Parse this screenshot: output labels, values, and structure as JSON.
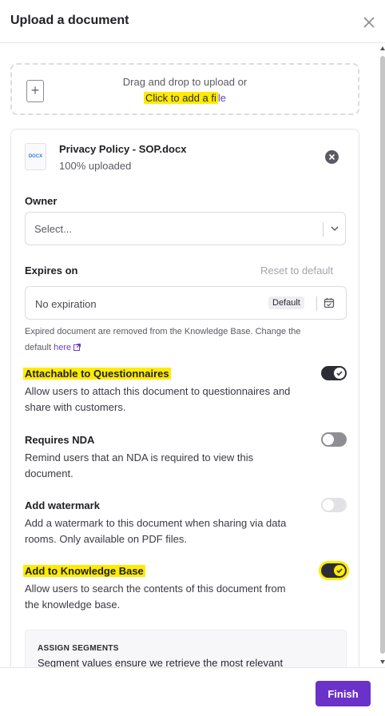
{
  "header": {
    "title": "Upload a document"
  },
  "dropzone": {
    "instruction": "Drag and drop to upload or",
    "link_text": "Click to add a fi",
    "link_tail": "le",
    "plus": "+"
  },
  "file": {
    "icon_label": "DOCX",
    "name": "Privacy Policy - SOP.docx",
    "status": "100% uploaded"
  },
  "owner": {
    "label": "Owner",
    "placeholder": "Select..."
  },
  "expires": {
    "label": "Expires on",
    "reset_label": "Reset to default",
    "value": "No expiration",
    "badge": "Default",
    "help_text_1": "Expired document are removed from the Knowledge Base. Change the",
    "help_text_2": "default",
    "help_link": "here"
  },
  "settings": [
    {
      "label": "Attachable to Questionnaires",
      "desc_1": "Allow users to attach this document to questionnaires and",
      "desc_2": "share with customers.",
      "state": "on"
    },
    {
      "label": "Requires NDA",
      "desc_1": "Remind users that an NDA is required to view this",
      "desc_2": "document.",
      "state": "off"
    },
    {
      "label": "Add watermark",
      "desc_1": "Add a watermark to this document when sharing via data",
      "desc_2": "rooms. Only available on PDF files.",
      "state": "disabled"
    },
    {
      "label": "Add to Knowledge Base",
      "desc_1": "Allow users to search the contents of this document from",
      "desc_2": "the knowledge base.",
      "state": "on"
    }
  ],
  "segments": {
    "title": "ASSIGN SEGMENTS",
    "desc": "Segment values ensure we retrieve the most relevant"
  },
  "footer": {
    "finish_label": "Finish"
  },
  "colors": {
    "accent": "#6a32c8",
    "highlight": "#ffeb00",
    "toggle_on": "#2c2c34"
  }
}
